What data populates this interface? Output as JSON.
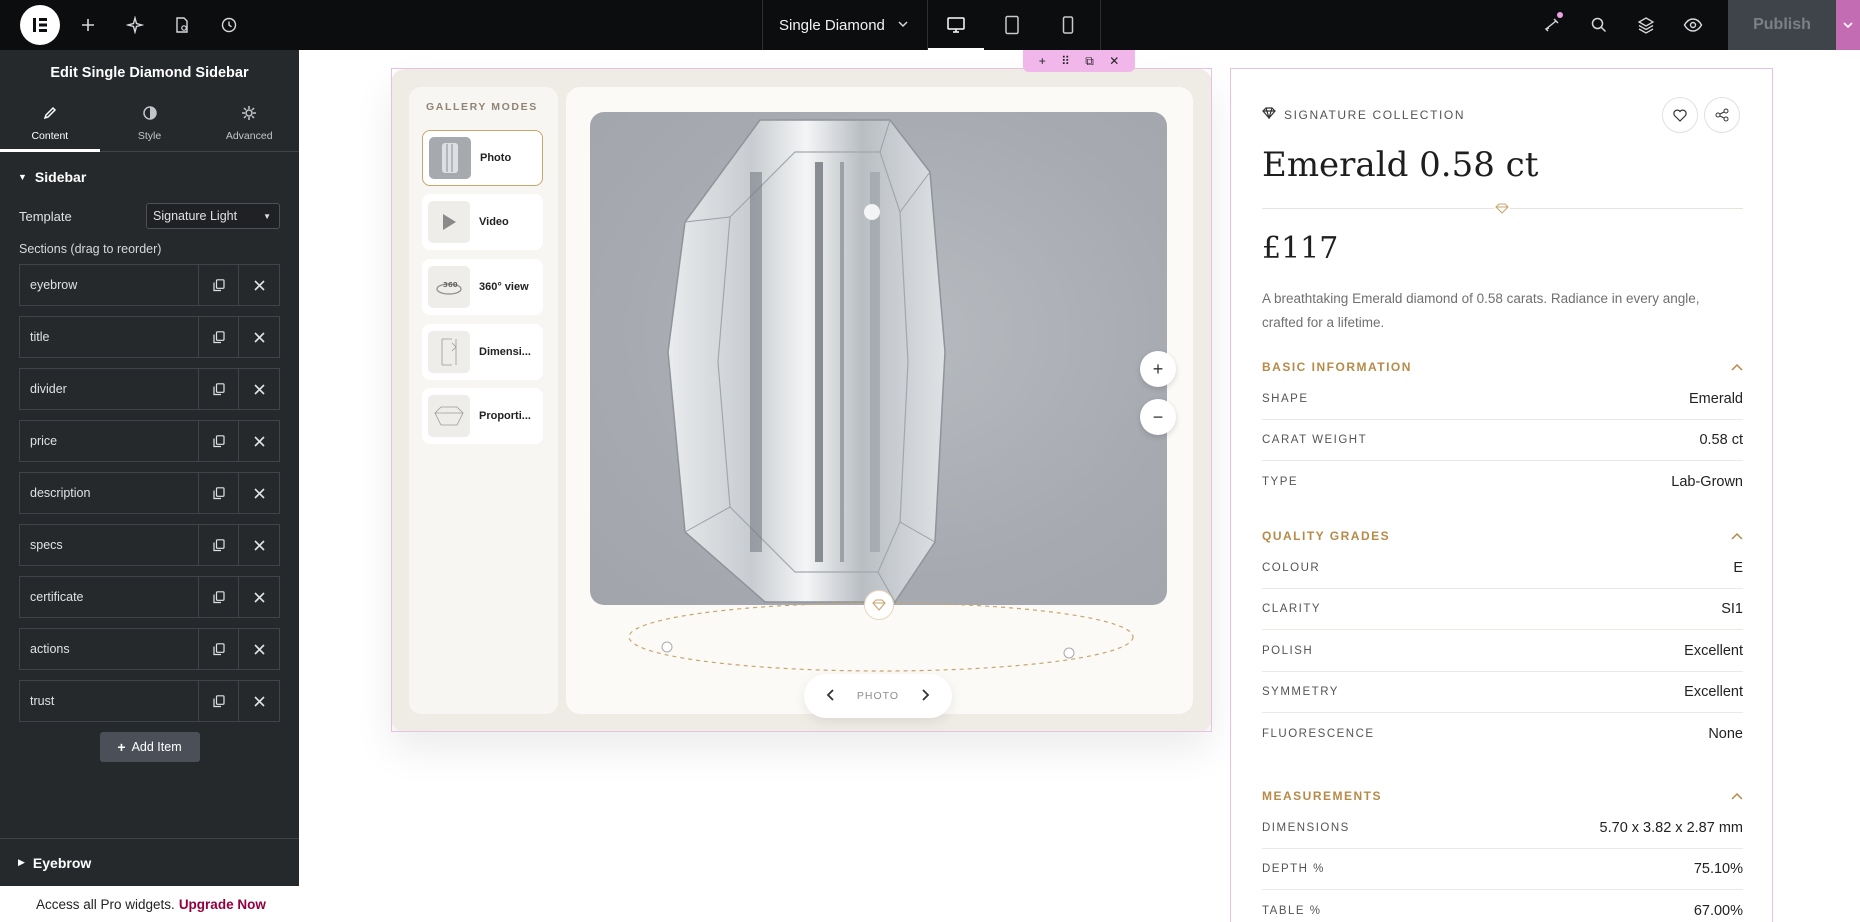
{
  "topbar": {
    "document_title": "Single Diamond",
    "publish_label": "Publish",
    "icons": [
      "elementor-logo-icon",
      "add-icon",
      "ai-sparkle-icon",
      "page-settings-icon",
      "history-icon",
      "chevron-down-icon",
      "desktop-icon",
      "tablet-icon",
      "mobile-icon",
      "notifications-icon",
      "search-icon",
      "structure-layers-icon",
      "preview-eye-icon"
    ]
  },
  "panel": {
    "title": "Edit Single Diamond Sidebar",
    "tabs": [
      {
        "label": "Content",
        "icon": "pencil-icon"
      },
      {
        "label": "Style",
        "icon": "half-circle-icon"
      },
      {
        "label": "Advanced",
        "icon": "gear-icon"
      }
    ],
    "section_title": "Sidebar",
    "template_label": "Template",
    "template_value": "Signature Light",
    "sections_label": "Sections (drag to reorder)",
    "items": [
      "eyebrow",
      "title",
      "divider",
      "price",
      "description",
      "specs",
      "certificate",
      "actions",
      "trust"
    ],
    "add_item_label": "Add Item",
    "eyebrow_section": "Eyebrow",
    "upgrade_text": "Access all Pro widgets.",
    "upgrade_link": "Upgrade Now"
  },
  "gallery": {
    "modes_title": "GALLERY MODES",
    "modes": [
      {
        "label": "Photo",
        "icon": "photo-thumb-icon"
      },
      {
        "label": "Video",
        "icon": "play-icon"
      },
      {
        "label": "360° view",
        "icon": "rotate-360-icon"
      },
      {
        "label": "Dimensi...",
        "icon": "dimensions-icon"
      },
      {
        "label": "Proporti...",
        "icon": "proportions-icon"
      }
    ],
    "pager_label": "PHOTO",
    "zoom_in": "+",
    "zoom_out": "−"
  },
  "sidebar": {
    "eyebrow": "SIGNATURE COLLECTION",
    "title": "Emerald 0.58 ct",
    "price": "£117",
    "description": "A breathtaking Emerald diamond of 0.58 carats. Radiance in every angle, crafted for a lifetime.",
    "groups": [
      {
        "title": "BASIC INFORMATION",
        "rows": [
          {
            "k": "SHAPE",
            "v": "Emerald"
          },
          {
            "k": "CARAT WEIGHT",
            "v": "0.58 ct"
          },
          {
            "k": "TYPE",
            "v": "Lab-Grown"
          }
        ]
      },
      {
        "title": "QUALITY GRADES",
        "rows": [
          {
            "k": "COLOUR",
            "v": "E"
          },
          {
            "k": "CLARITY",
            "v": "SI1"
          },
          {
            "k": "POLISH",
            "v": "Excellent"
          },
          {
            "k": "SYMMETRY",
            "v": "Excellent"
          },
          {
            "k": "FLUORESCENCE",
            "v": "None"
          }
        ]
      },
      {
        "title": "MEASUREMENTS",
        "rows": [
          {
            "k": "DIMENSIONS",
            "v": "5.70 x 3.82 x 2.87 mm"
          },
          {
            "k": "DEPTH %",
            "v": "75.10%"
          },
          {
            "k": "TABLE %",
            "v": "67.00%"
          }
        ]
      }
    ]
  },
  "colors": {
    "accent_gold": "#b78a48",
    "editor_dark": "#26292c",
    "selection_pink": "#e6c2e0",
    "upgrade_link": "#93003f"
  }
}
